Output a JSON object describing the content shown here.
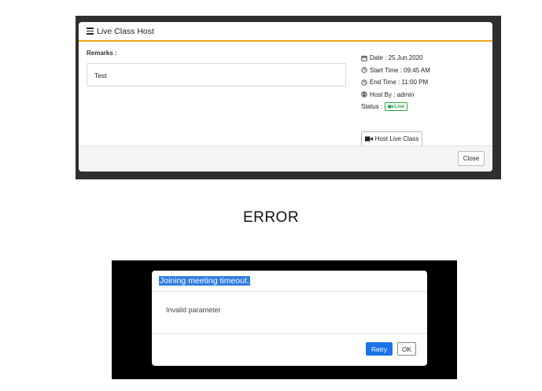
{
  "top_dialog": {
    "title": "Live Class Host",
    "remarks_label": "Remarks :",
    "remarks_value": "Test",
    "date": "Date : 25.Jun.2020",
    "start_time": "Start Time : 09:45 AM",
    "end_time": "End Time : 11:00 PM",
    "host_by": "Host By : admin",
    "status_label": "Status :",
    "status_badge": "Live",
    "host_button": "Host Live Class",
    "close_button": "Close",
    "accent_color": "#f0a418",
    "badge_color": "#28a745"
  },
  "caption": "ERROR",
  "error_dialog": {
    "title": "Joining meeting timeout.",
    "message": "Invalid parameter",
    "retry_button": "Retry",
    "ok_button": "OK",
    "primary_color": "#1a73e8"
  },
  "icons": [
    "menu-icon",
    "calendar-icon",
    "clock-icon",
    "clock-icon",
    "user-circle-icon",
    "video-icon"
  ]
}
